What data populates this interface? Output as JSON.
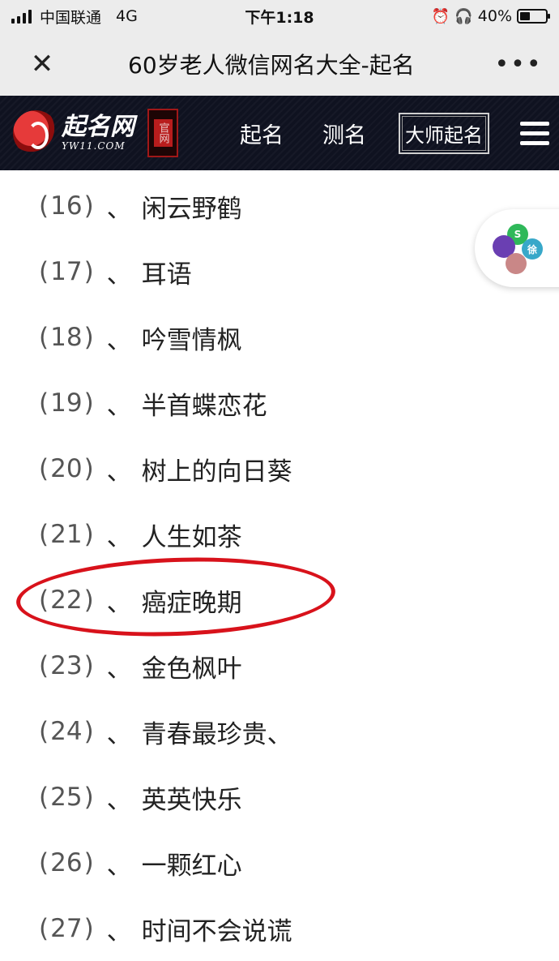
{
  "status_bar": {
    "carrier": "中国联通",
    "network": "4G",
    "time": "下午1:18",
    "battery": "40%",
    "battery_level": 0.4
  },
  "nav_bar": {
    "title": "60岁老人微信网名大全-起名",
    "close_icon": "close-icon",
    "more_icon": "more-icon"
  },
  "site_header": {
    "logo_cn": "起名网",
    "logo_en": "YW11.COM",
    "official_badge": "官网",
    "nav": {
      "naming": "起名",
      "testing": "测名",
      "master": "大师起名"
    }
  },
  "names": [
    {
      "open": "(",
      "num": "16",
      "close": ")",
      "sep": "、",
      "name": "闲云野鹤"
    },
    {
      "open": "(",
      "num": "17",
      "close": ")",
      "sep": "、",
      "name": "耳语"
    },
    {
      "open": "(",
      "num": "18",
      "close": ")",
      "sep": "、",
      "name": "吟雪情枫"
    },
    {
      "open": "(",
      "num": "19",
      "close": ")",
      "sep": "、",
      "name": "半首蝶恋花"
    },
    {
      "open": "(",
      "num": "20",
      "close": ")",
      "sep": "、",
      "name": "树上的向日葵"
    },
    {
      "open": "(",
      "num": "21",
      "close": ")",
      "sep": "、",
      "name": "人生如茶"
    },
    {
      "open": "(",
      "num": "22",
      "close": ")",
      "sep": "、",
      "name": "癌症晚期"
    },
    {
      "open": "(",
      "num": "23",
      "close": ")",
      "sep": "、",
      "name": "金色枫叶"
    },
    {
      "open": "(",
      "num": "24",
      "close": ")",
      "sep": "、",
      "name": "青春最珍贵、"
    },
    {
      "open": "(",
      "num": "25",
      "close": ")",
      "sep": "、",
      "name": "英英快乐"
    },
    {
      "open": "(",
      "num": "26",
      "close": ")",
      "sep": "、",
      "name": "一颗红心"
    },
    {
      "open": "(",
      "num": "27",
      "close": ")",
      "sep": "、",
      "name": "时间不会说谎"
    }
  ],
  "float_widget": {
    "label_a": "S",
    "label_b": "徐"
  },
  "colors": {
    "header_bg": "#0f1220",
    "highlight": "#d8121b",
    "chrome_bg": "#ececec"
  }
}
